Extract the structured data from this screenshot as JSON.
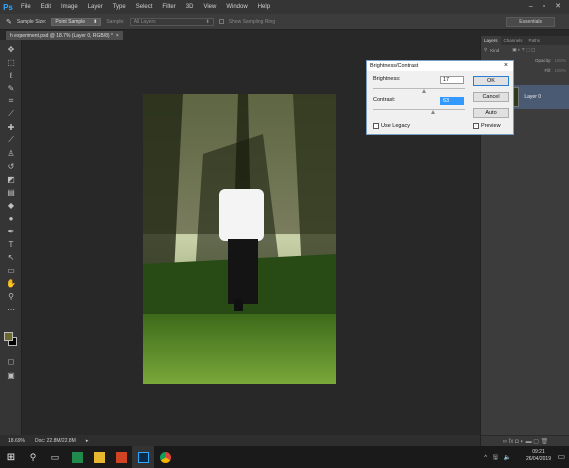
{
  "app": {
    "logo": "Ps",
    "window_controls": "– ▫ ✕"
  },
  "menu": [
    "File",
    "Edit",
    "Image",
    "Layer",
    "Type",
    "Select",
    "Filter",
    "3D",
    "View",
    "Window",
    "Help"
  ],
  "options_bar": {
    "tool_icon": "eyedropper-icon",
    "sample_size_label": "Sample Size:",
    "sample_size_value": "Point Sample",
    "sample_label": "Sample:",
    "sample_value": "All Layers",
    "show_ring_label": "Show Sampling Ring",
    "workspace": "Essentials"
  },
  "document_tab": {
    "title": "h experiment.psd @ 18.7% (Layer 0, RGB/8) *",
    "close": "×"
  },
  "status_bar": {
    "zoom": "18.69%",
    "doc": "Doc: 22.8M/22.8M"
  },
  "panel": {
    "tabs": [
      "Layers",
      "Channels",
      "Paths"
    ],
    "kind_label": "Kind",
    "opacity_label": "Opacity:",
    "opacity_value": "100%",
    "fill_label": "Fill:",
    "fill_value": "100%",
    "layer_name": "Layer 0",
    "bottom_icons": "∞ fx ◘ ◐ ▬ ▢ 🗑"
  },
  "dialog": {
    "title": "Brightness/Contrast",
    "close": "×",
    "brightness_label": "Brightness:",
    "brightness_value": "17",
    "contrast_label": "Contrast:",
    "contrast_value": "63",
    "use_legacy_label": "Use Legacy",
    "use_legacy_checked": false,
    "ok_label": "OK",
    "cancel_label": "Cancel",
    "auto_label": "Auto",
    "preview_label": "Preview",
    "preview_checked": true
  },
  "taskbar": {
    "time": "09:21",
    "date": "26/04/2019",
    "tray": "^ 🖫 🔈"
  },
  "colors": {
    "accent": "#31a8ff",
    "foreground_swatch": "#6b6a2c",
    "background_swatch": "#000000"
  }
}
